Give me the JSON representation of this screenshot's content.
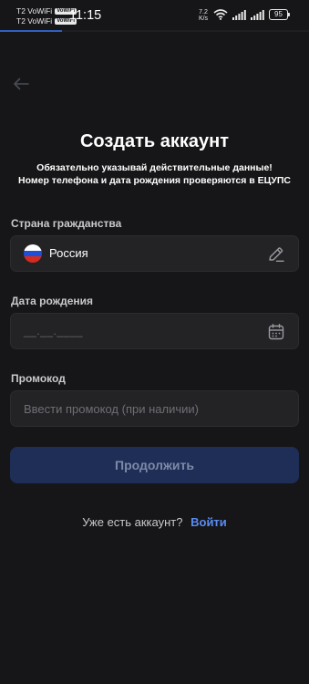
{
  "status_bar": {
    "carrier_1": "T2 VoWiFi",
    "carrier_2": "T2 VoWiFi",
    "volte_badge": "VoWiFi",
    "time": "11:15",
    "net_speed_value": "7.2",
    "net_speed_unit": "K/s",
    "battery": "95",
    "progress_fraction": 0.2
  },
  "header": {
    "back_icon": "arrow-left-icon",
    "title": "Создать аккаунт",
    "subtitle_line1": "Обязательно указывай действительные данные!",
    "subtitle_line2": "Номер телефона и дата рождения проверяются в ЕЦУПС"
  },
  "form": {
    "citizenship": {
      "label": "Страна гражданства",
      "value": "Россия",
      "flag_icon": "russia-flag-icon",
      "edit_icon": "pencil-icon"
    },
    "birth_date": {
      "label": "Дата рождения",
      "mask": "__.__.____",
      "calendar_icon": "calendar-icon"
    },
    "promo": {
      "label": "Промокод",
      "value": "",
      "placeholder": "Ввести промокод (при наличии)"
    },
    "continue_label": "Продолжить"
  },
  "login": {
    "question": "Уже есть аккаунт?",
    "link": "Войти"
  },
  "colors": {
    "background": "#161618",
    "field_background": "#232326",
    "accent": "#5b8cf0",
    "button_disabled": "#1e2e57"
  }
}
